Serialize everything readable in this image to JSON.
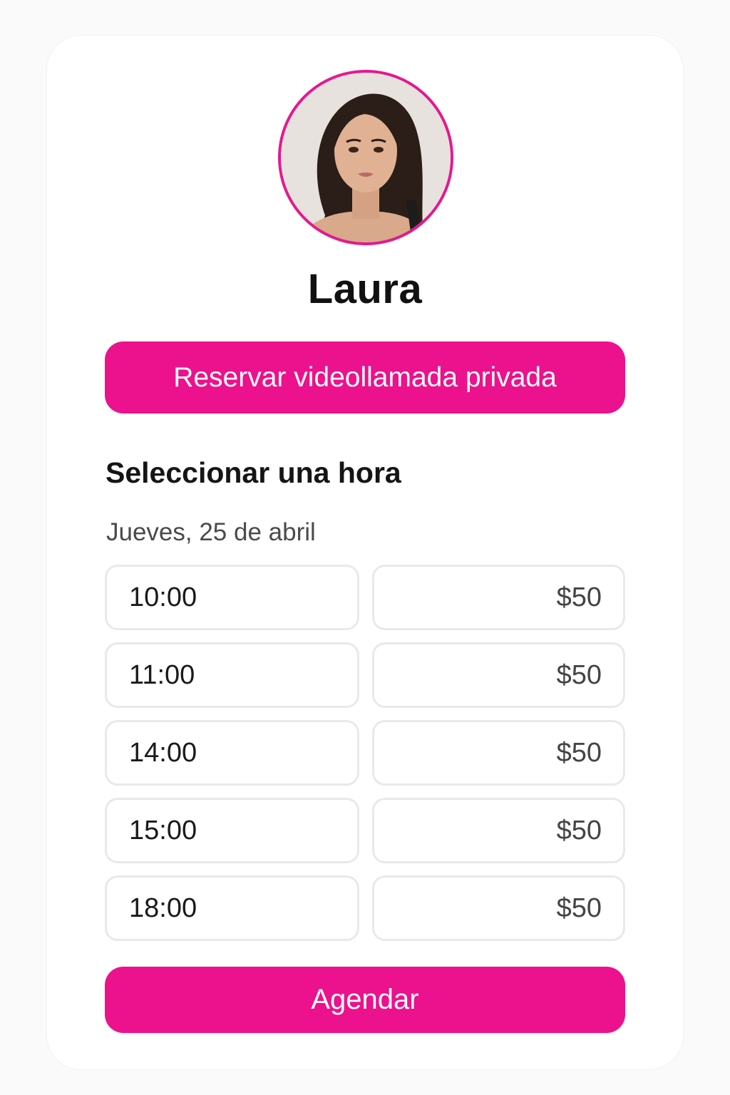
{
  "profile": {
    "name": "Laura",
    "avatar_icon": "profile-photo"
  },
  "actions": {
    "reserve_label": "Reservar videollamada privada",
    "schedule_label": "Agendar"
  },
  "schedule": {
    "title": "Seleccionar una hora",
    "date": "Jueves, 25 de abril",
    "slots": [
      {
        "time": "10:00",
        "price": "$50"
      },
      {
        "time": "11:00",
        "price": "$50"
      },
      {
        "time": "14:00",
        "price": "$50"
      },
      {
        "time": "15:00",
        "price": "$50"
      },
      {
        "time": "18:00",
        "price": "$50"
      }
    ]
  },
  "colors": {
    "accent": "#ec118c",
    "background": "#fafafa",
    "card": "#ffffff",
    "border": "#e9e9e9"
  }
}
